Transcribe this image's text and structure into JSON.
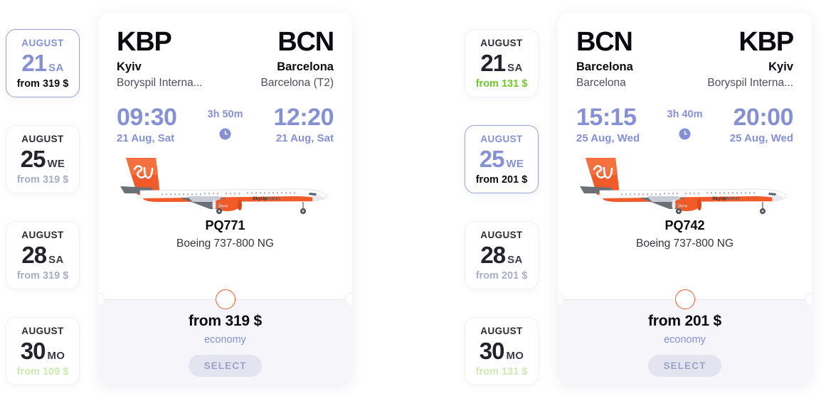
{
  "outbound": {
    "dates": [
      {
        "month": "AUGUST",
        "day": "21",
        "dow": "SA",
        "price": "from 319 $",
        "selected": true,
        "price_style": "normal"
      },
      {
        "month": "AUGUST",
        "day": "25",
        "dow": "WE",
        "price": "from 319 $",
        "selected": false,
        "price_style": "normal"
      },
      {
        "month": "AUGUST",
        "day": "28",
        "dow": "SA",
        "price": "from 319 $",
        "selected": false,
        "price_style": "normal"
      },
      {
        "month": "AUGUST",
        "day": "30",
        "dow": "MO",
        "price": "from 109 $",
        "selected": false,
        "price_style": "green-faded"
      }
    ],
    "flight": {
      "origin_code": "KBP",
      "origin_city": "Kyiv",
      "origin_airport": "Boryspil Interna...",
      "dest_code": "BCN",
      "dest_city": "Barcelona",
      "dest_airport": "Barcelona (T2)",
      "depart_time": "09:30",
      "depart_date": "21 Aug, Sat",
      "duration": "3h 50m",
      "arrive_time": "12:20",
      "arrive_date": "21 Aug, Sat",
      "flight_number": "PQ771",
      "aircraft": "Boeing 737-800 NG",
      "fare_prefix": "from",
      "fare_amount": "319 $",
      "cabin": "economy",
      "select_label": "SELECT"
    }
  },
  "inbound": {
    "dates": [
      {
        "month": "AUGUST",
        "day": "21",
        "dow": "SA",
        "price": "from 131 $",
        "selected": false,
        "price_style": "green"
      },
      {
        "month": "AUGUST",
        "day": "25",
        "dow": "WE",
        "price": "from 201 $",
        "selected": true,
        "price_style": "normal"
      },
      {
        "month": "AUGUST",
        "day": "28",
        "dow": "SA",
        "price": "from 201 $",
        "selected": false,
        "price_style": "normal"
      },
      {
        "month": "AUGUST",
        "day": "30",
        "dow": "MO",
        "price": "from 131 $",
        "selected": false,
        "price_style": "green-faded"
      }
    ],
    "flight": {
      "origin_code": "BCN",
      "origin_city": "Barcelona",
      "origin_airport": "Barcelona",
      "dest_code": "KBP",
      "dest_city": "Kyiv",
      "dest_airport": "Boryspil Interna...",
      "depart_time": "15:15",
      "depart_date": "25 Aug, Wed",
      "duration": "3h 40m",
      "arrive_time": "20:00",
      "arrive_date": "25 Aug, Wed",
      "flight_number": "PQ742",
      "aircraft": "Boeing 737-800 NG",
      "fare_prefix": "from",
      "fare_amount": "201 $",
      "cabin": "economy",
      "select_label": "SELECT"
    }
  },
  "icons": {
    "clock": "clock-icon",
    "plane": "airplane-illustration"
  },
  "colors": {
    "accent_blue": "#8591d4",
    "accent_orange": "#f15a29",
    "price_green": "#6ec82a",
    "text_dark": "#0a0a10",
    "panel_bg": "#f5f5fa"
  }
}
